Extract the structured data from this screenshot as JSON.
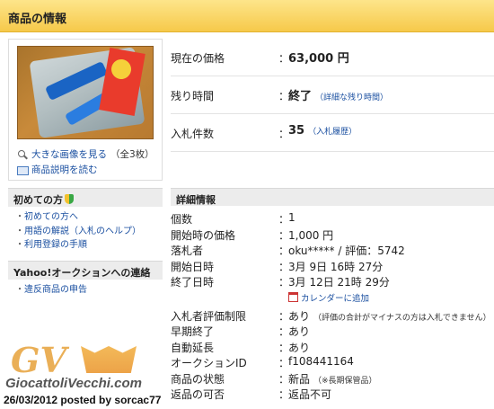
{
  "header": {
    "title": "商品の情報"
  },
  "photo": {
    "enlarge_link": "大きな画像を見る",
    "image_count": "（全3枚）",
    "description_link": "商品説明を読む"
  },
  "price": {
    "current_label": "現在の価格",
    "current_value": "63,000 円",
    "remaining_label": "残り時間",
    "remaining_value": "終了",
    "remaining_link": "（詳細な残り時間）",
    "bids_label": "入札件数",
    "bids_value": "35",
    "bids_link": "（入札履歴）"
  },
  "sidebar": {
    "first_time": {
      "title": "初めての方",
      "items": [
        "初めての方へ",
        "用語の解説（入札のヘルプ）",
        "利用登録の手順"
      ]
    },
    "contact": {
      "title": "Yahoo!オークションへの連絡",
      "items": [
        "違反商品の申告"
      ]
    }
  },
  "details": {
    "title": "詳細情報",
    "rows": [
      {
        "label": "個数",
        "value": "1",
        "note": ""
      },
      {
        "label": "開始時の価格",
        "value": "1,000 円",
        "note": ""
      },
      {
        "label": "落札者",
        "value": "oku***** / 評価：5742",
        "note": ""
      },
      {
        "label": "開始日時",
        "value": "3月 9日 16時 27分",
        "note": ""
      },
      {
        "label": "終了日時",
        "value": "3月 12日 21時 29分",
        "note": ""
      }
    ],
    "calendar_link": "カレンダーに追加",
    "rows2": [
      {
        "label": "入札者評価制限",
        "value": "あり",
        "note": "（評価の合計がマイナスの方は入札できません）"
      },
      {
        "label": "早期終了",
        "value": "あり",
        "note": ""
      },
      {
        "label": "自動延長",
        "value": "あり",
        "note": ""
      },
      {
        "label": "オークションID",
        "value": "f108441164",
        "note": ""
      },
      {
        "label": "商品の状態",
        "value": "新品",
        "note": "（※長期保管品）"
      },
      {
        "label": "返品の可否",
        "value": "返品不可",
        "note": ""
      }
    ]
  },
  "watermark": {
    "logo": "GV",
    "site": "GiocattoliVecchi.com",
    "credit": "26/03/2012 posted by sorcac77"
  }
}
